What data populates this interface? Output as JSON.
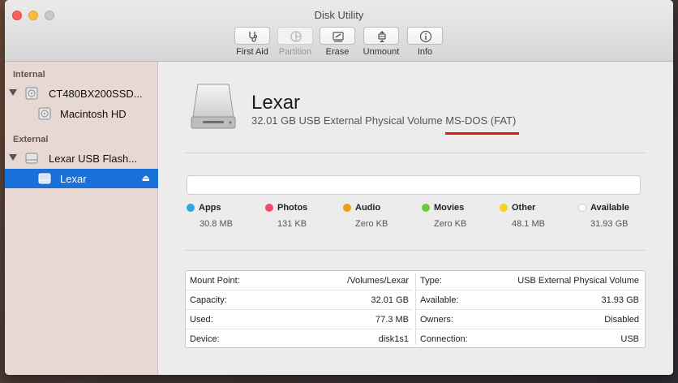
{
  "window": {
    "title": "Disk Utility"
  },
  "toolbar": {
    "first_aid": "First Aid",
    "partition": "Partition",
    "erase": "Erase",
    "unmount": "Unmount",
    "info": "Info"
  },
  "sidebar": {
    "internal_label": "Internal",
    "external_label": "External",
    "items": [
      {
        "label": "CT480BX200SSD..."
      },
      {
        "label": "Macintosh HD"
      },
      {
        "label": "Lexar USB Flash..."
      },
      {
        "label": "Lexar"
      }
    ]
  },
  "volume": {
    "name": "Lexar",
    "description": "32.01 GB USB External Physical Volume",
    "format": "MS-DOS (FAT)"
  },
  "legend": [
    {
      "name": "Apps",
      "value": "30.8 MB",
      "color": "#2ea7e0"
    },
    {
      "name": "Photos",
      "value": "131 KB",
      "color": "#f04b6e"
    },
    {
      "name": "Audio",
      "value": "Zero KB",
      "color": "#f39c12"
    },
    {
      "name": "Movies",
      "value": "Zero KB",
      "color": "#6bcb3b"
    },
    {
      "name": "Other",
      "value": "48.1 MB",
      "color": "#f6d21c"
    },
    {
      "name": "Available",
      "value": "31.93 GB",
      "color": "#ffffff"
    }
  ],
  "info": {
    "left": [
      {
        "key": "Mount Point:",
        "value": "/Volumes/Lexar"
      },
      {
        "key": "Capacity:",
        "value": "32.01 GB"
      },
      {
        "key": "Used:",
        "value": "77.3 MB"
      },
      {
        "key": "Device:",
        "value": "disk1s1"
      }
    ],
    "right": [
      {
        "key": "Type:",
        "value": "USB External Physical Volume"
      },
      {
        "key": "Available:",
        "value": "31.93 GB"
      },
      {
        "key": "Owners:",
        "value": "Disabled"
      },
      {
        "key": "Connection:",
        "value": "USB"
      }
    ]
  },
  "colors": {
    "selection": "#1a71d9",
    "annotation_underline": "#e0190f"
  }
}
